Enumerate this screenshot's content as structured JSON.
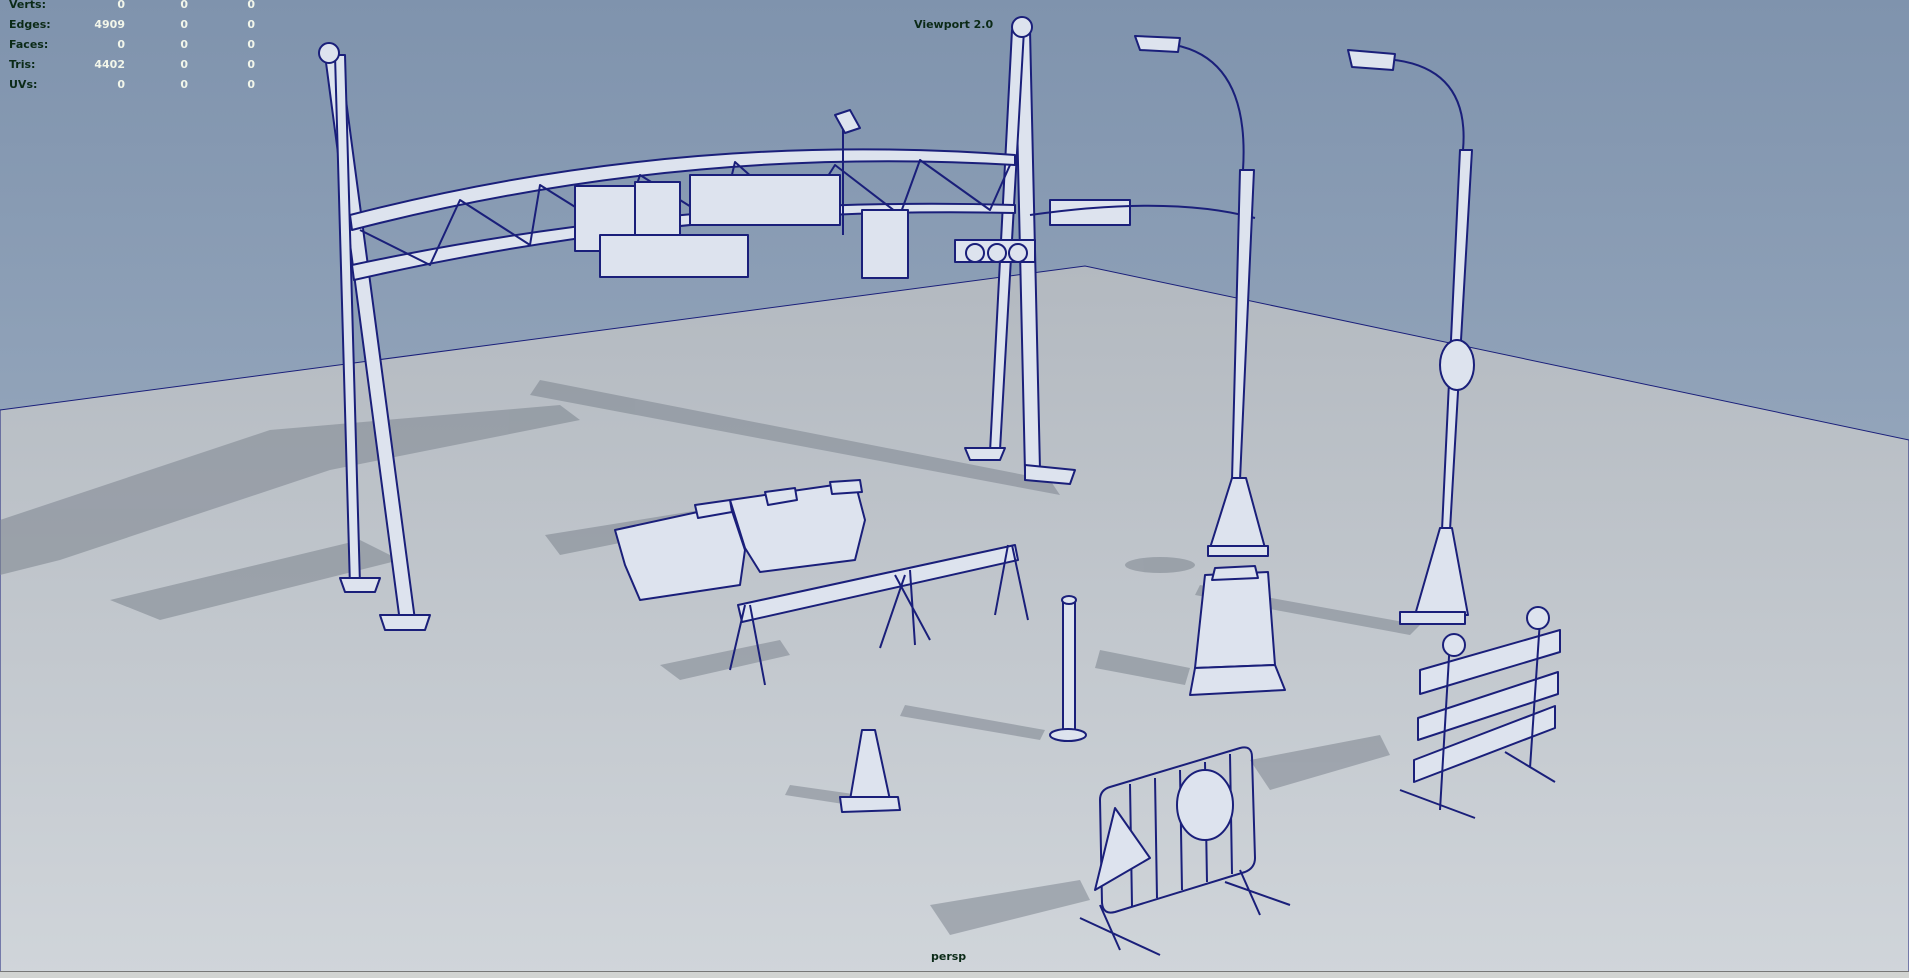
{
  "viewport": {
    "title": "Viewport 2.0",
    "camera": "persp"
  },
  "hud": {
    "rows": [
      {
        "label": "Verts:",
        "values": [
          "0",
          "0",
          "0"
        ]
      },
      {
        "label": "Edges:",
        "values": [
          "4909",
          "0",
          "0"
        ]
      },
      {
        "label": "Faces:",
        "values": [
          "0",
          "0",
          "0"
        ]
      },
      {
        "label": "Tris:",
        "values": [
          "4402",
          "0",
          "0"
        ]
      },
      {
        "label": "UVs:",
        "values": [
          "0",
          "0",
          "0"
        ]
      }
    ]
  },
  "colors": {
    "sky_top": "#7f93ad",
    "sky_bottom": "#a3b4c6",
    "ground": "#c2c8cd",
    "wireframe": "#1a1f7a",
    "model_fill": "#dde3ee",
    "hud_label": "#0b2a17",
    "hud_value": "#f2f6ea"
  }
}
